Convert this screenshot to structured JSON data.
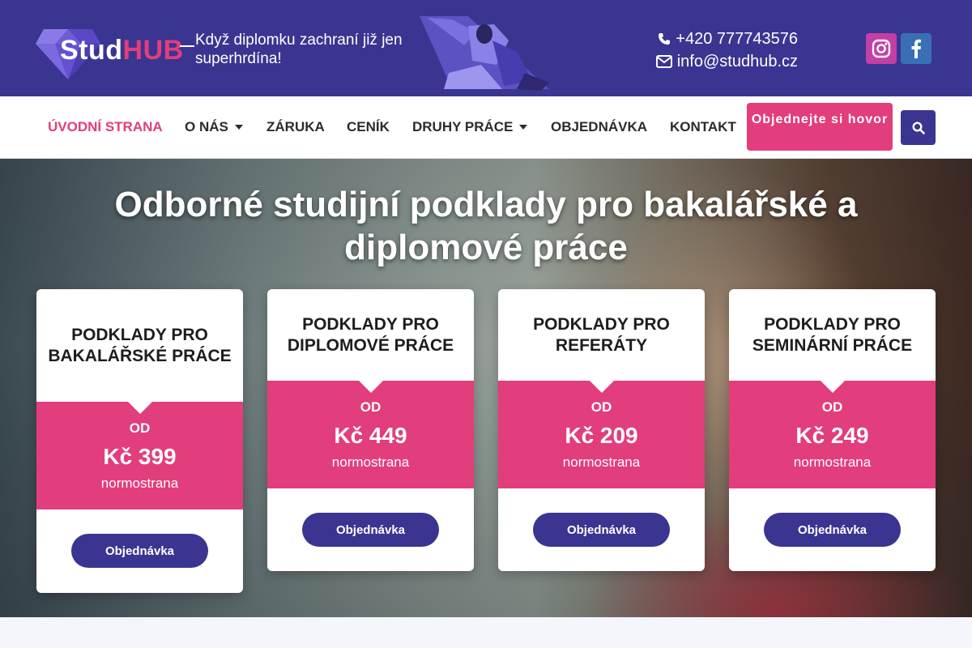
{
  "brand": {
    "name_part1": "Stud",
    "name_part2": "HUB",
    "tagline": "Když diplomku zachraní již jen superhrdína!"
  },
  "contact": {
    "phone": "+420 777743576",
    "email": "info@studhub.cz"
  },
  "social": [
    {
      "icon": "instagram-icon"
    },
    {
      "icon": "facebook-icon"
    }
  ],
  "nav": {
    "items": [
      {
        "label": "ÚVODNÍ STRANA",
        "active": true
      },
      {
        "label": "O NÁS",
        "dropdown": true
      },
      {
        "label": "ZÁRUKA"
      },
      {
        "label": "CENÍK"
      },
      {
        "label": "DRUHY PRÁCE",
        "dropdown": true
      },
      {
        "label": "OBJEDNÁVKA"
      },
      {
        "label": "KONTAKT"
      }
    ],
    "call_button": "Objednejte si hovor",
    "search_icon": "search-icon"
  },
  "hero": {
    "title": "Odborné studijní podklady pro bakalářské a diplomové práce",
    "cards": [
      {
        "title": "PODKLADY PRO BAKALÁŘSKÉ PRÁCE",
        "from": "OD",
        "price": "Kč 399",
        "unit": "normostrana",
        "button": "Objednávka"
      },
      {
        "title": "PODKLADY PRO DIPLOMOVÉ PRÁCE",
        "from": "OD",
        "price": "Kč 449",
        "unit": "normostrana",
        "button": "Objednávka"
      },
      {
        "title": "PODKLADY PRO REFERÁTY",
        "from": "OD",
        "price": "Kč 209",
        "unit": "normostrana",
        "button": "Objednávka"
      },
      {
        "title": "PODKLADY PRO SEMINÁRNÍ PRÁCE",
        "from": "OD",
        "price": "Kč 249",
        "unit": "normostrana",
        "button": "Objednávka"
      }
    ]
  },
  "colors": {
    "primary": "#3a3591",
    "accent": "#e23d7c",
    "instagram": "#c23fa6",
    "facebook": "#3b6fb5"
  }
}
